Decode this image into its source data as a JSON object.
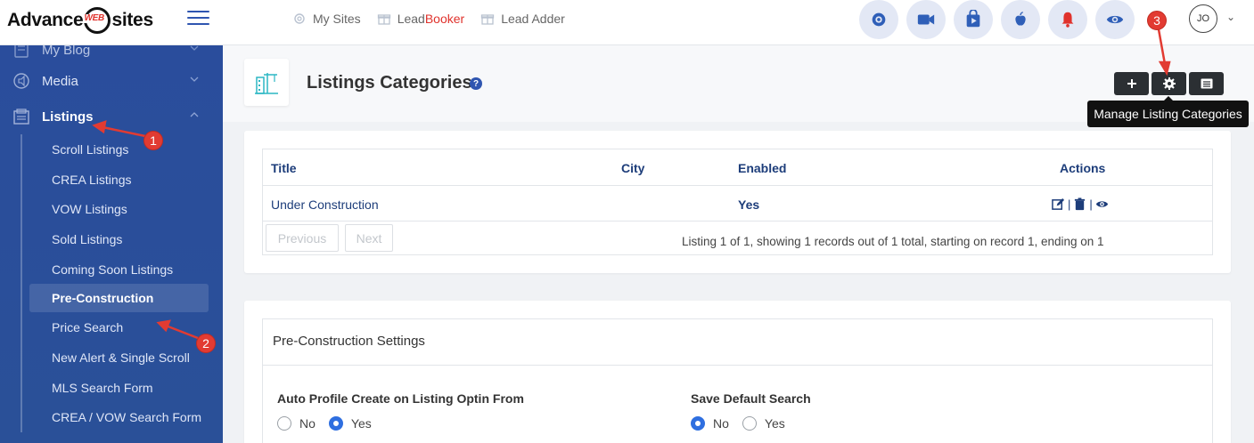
{
  "brand": {
    "logo_left": "Advance",
    "logo_mid": "WEB",
    "logo_right": "sites"
  },
  "topnav": {
    "links": [
      {
        "label": "My Sites"
      },
      {
        "label_a": "Lead",
        "label_b": "Booker"
      },
      {
        "label": "Lead Adder"
      }
    ],
    "icons": [
      "settings-gear-icon",
      "video-camera-icon",
      "play-store-icon",
      "apple-icon",
      "bell-icon",
      "eye-icon"
    ],
    "avatar": "JO",
    "accent": "#2f55b0",
    "danger": "#e0322c"
  },
  "sidebar": {
    "items": [
      {
        "label": "My Blog"
      },
      {
        "label": "Media"
      },
      {
        "label": "Listings"
      }
    ],
    "sub_items": [
      "Scroll Listings",
      "CREA Listings",
      "VOW Listings",
      "Sold Listings",
      "Coming Soon Listings",
      "Pre-Construction",
      "Price Search",
      "New Alert & Single Scroll",
      "MLS Search Form",
      "CREA / VOW Search Form"
    ],
    "active": "Pre-Construction"
  },
  "header": {
    "title": "Listings Categories",
    "help": "?",
    "tooltip": "Manage Listing Categories"
  },
  "table": {
    "columns": [
      "Title",
      "City",
      "Enabled",
      "Actions"
    ],
    "rows": [
      {
        "title": "Under Construction",
        "city": "",
        "enabled": "Yes"
      }
    ],
    "prev_label": "Previous",
    "next_label": "Next",
    "info": "Listing 1 of 1, showing 1 records out of 1 total, starting on record 1, ending on 1"
  },
  "settings": {
    "title": "Pre-Construction Settings",
    "fields": [
      {
        "label": "Auto Profile Create on Listing Optin From",
        "options": [
          "No",
          "Yes"
        ],
        "selected": "Yes"
      },
      {
        "label": "Save Default Search",
        "options": [
          "No",
          "Yes"
        ],
        "selected": "No"
      }
    ]
  },
  "annotations": [
    "1",
    "2",
    "3"
  ]
}
